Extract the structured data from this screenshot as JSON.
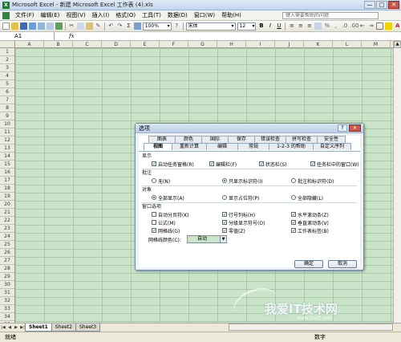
{
  "window": {
    "title": "Microsoft Excel - 新建 Microsoft Excel 工作表 (4).xls",
    "min": "—",
    "max": "□",
    "close": "✕"
  },
  "menu": {
    "items": [
      "文件(F)",
      "编辑(E)",
      "视图(V)",
      "插入(I)",
      "格式(O)",
      "工具(T)",
      "数据(D)",
      "窗口(W)",
      "帮助(H)"
    ],
    "help_placeholder": "键入需要帮助的问题"
  },
  "toolbar": {
    "zoom": "100%",
    "font": "宋体",
    "size": "12",
    "bold": "B",
    "italic": "I",
    "underline": "U"
  },
  "formula": {
    "namebox": "A1",
    "fx": "fx"
  },
  "grid": {
    "columns": [
      "A",
      "B",
      "C",
      "D",
      "E",
      "F",
      "G",
      "H",
      "I",
      "J",
      "K",
      "L",
      "M"
    ],
    "rows": [
      "1",
      "2",
      "3",
      "4",
      "5",
      "6",
      "7",
      "8",
      "9",
      "10",
      "11",
      "12",
      "13",
      "14",
      "15",
      "16",
      "17",
      "18",
      "19",
      "20",
      "21",
      "22",
      "23",
      "24",
      "25",
      "26",
      "27",
      "28",
      "29",
      "30",
      "31",
      "32",
      "33",
      "34",
      "35"
    ]
  },
  "sheets": {
    "tabs": [
      "Sheet1",
      "Sheet2",
      "Sheet3"
    ],
    "active": "Sheet1"
  },
  "status": {
    "left": "就绪",
    "right": "数字"
  },
  "watermark": {
    "text": "我爱IT技术网",
    "url": "www.5aitt.com"
  },
  "dialog": {
    "title": "选项",
    "help": "?",
    "close": "✕",
    "tabs_top": [
      "图表",
      "颜色",
      "国际",
      "保存",
      "错误检查",
      "拼写检查",
      "安全性"
    ],
    "tabs_bottom": [
      "视图",
      "重新计算",
      "编辑",
      "常规",
      "1-2-3 的帮助",
      "自定义序列"
    ],
    "active_tab": "视图",
    "show": {
      "heading": "显示",
      "options": [
        {
          "label": "启动任务窗格(R)",
          "checked": true
        },
        {
          "label": "编辑栏(F)",
          "checked": true
        },
        {
          "label": "状态栏(S)",
          "checked": true
        },
        {
          "label": "任务栏中的窗口(W)",
          "checked": true
        }
      ]
    },
    "comments": {
      "heading": "批注",
      "options": [
        {
          "label": "无(N)",
          "selected": false
        },
        {
          "label": "只显示标识符(I)",
          "selected": true
        },
        {
          "label": "批注和标识符(D)",
          "selected": false
        }
      ]
    },
    "objects": {
      "heading": "对象",
      "options": [
        {
          "label": "全部显示(A)",
          "selected": true
        },
        {
          "label": "显示占位符(P)",
          "selected": false
        },
        {
          "label": "全部隐藏(L)",
          "selected": false
        }
      ]
    },
    "window_options": {
      "heading": "窗口选项",
      "options": [
        {
          "label": "自动分页符(K)",
          "checked": false
        },
        {
          "label": "行号列标(H)",
          "checked": true
        },
        {
          "label": "水平滚动条(Z)",
          "checked": true
        },
        {
          "label": "公式(M)",
          "checked": false
        },
        {
          "label": "分级显示符号(O)",
          "checked": true
        },
        {
          "label": "垂直滚动条(V)",
          "checked": true
        },
        {
          "label": "网格线(G)",
          "checked": true
        },
        {
          "label": "零值(Z)",
          "checked": true
        },
        {
          "label": "工作表标签(B)",
          "checked": true
        }
      ]
    },
    "gridline_color": {
      "label": "网格线颜色(C):",
      "value": "自动",
      "swatch": "#c9e4c9"
    },
    "ok": "确定",
    "cancel": "取消"
  }
}
